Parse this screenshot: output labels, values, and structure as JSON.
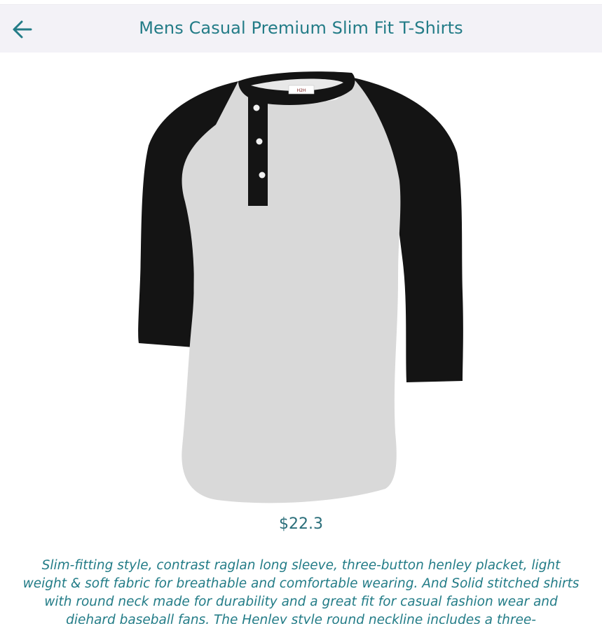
{
  "header": {
    "title": "Mens Casual Premium Slim Fit T-Shirts",
    "back_icon": "arrow-left-icon"
  },
  "product": {
    "image_label": "H2H",
    "price": "$22.3",
    "description": "Slim-fitting style, contrast raglan long sleeve, three-button henley placket, light weight & soft fabric for breathable and comfortable wearing. And Solid stitched shirts with round neck made for durability and a great fit for casual fashion wear and diehard baseball fans. The Henley style round neckline includes a three-"
  },
  "colors": {
    "accent": "#237c87",
    "header_bg": "#f3f2f7",
    "shirt_body": "#d9d9d9",
    "shirt_sleeve": "#141414"
  }
}
